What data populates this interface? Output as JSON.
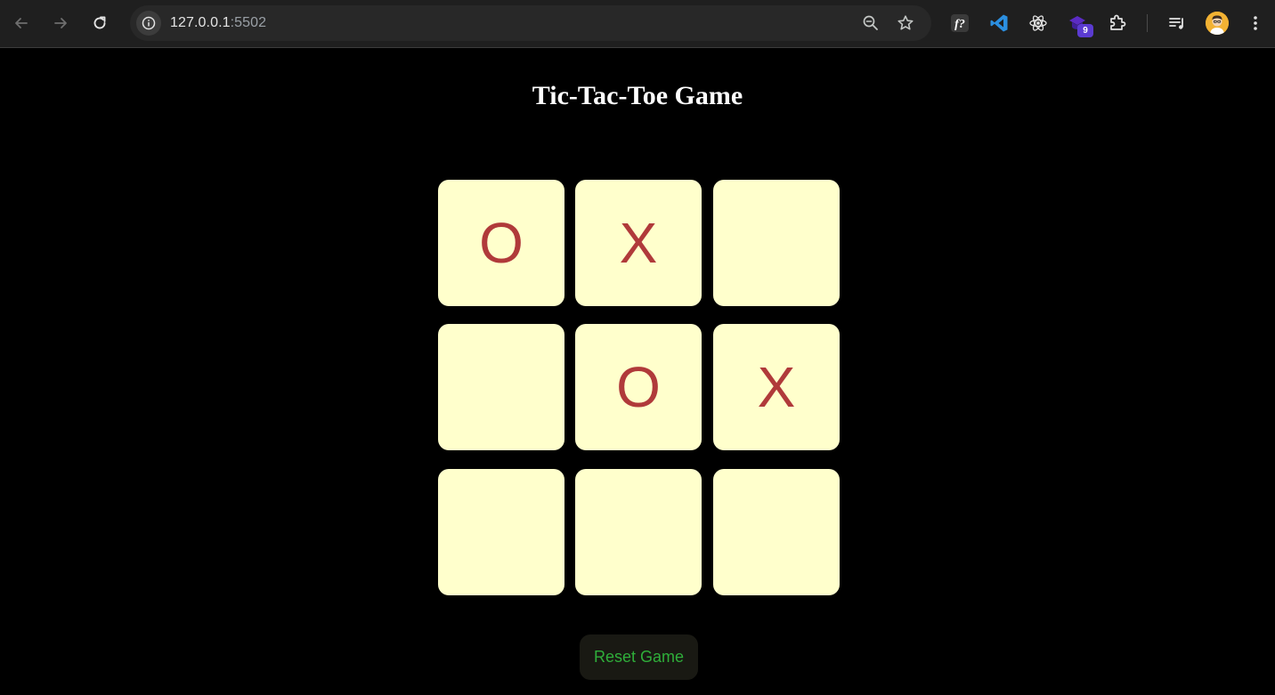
{
  "browser": {
    "url_host": "127.0.0.1",
    "url_port": ":5502",
    "extension_badge": "9"
  },
  "page": {
    "title": "Tic-Tac-Toe Game",
    "board": [
      "O",
      "X",
      "",
      "",
      "O",
      "X",
      "",
      "",
      ""
    ],
    "reset_label": "Reset Game"
  },
  "colors": {
    "background": "#000000",
    "cell": "#ffffcc",
    "mark": "#b03a3a",
    "reset_text": "#2fae3a",
    "reset_bg": "#191913"
  },
  "icons": {
    "toolbar": [
      "back-icon",
      "forward-icon",
      "reload-icon"
    ],
    "omnibox": [
      "site-info-icon",
      "zoom-icon",
      "bookmark-star-icon"
    ],
    "extensions": [
      "function-extension-icon",
      "vscode-icon",
      "react-devtools-icon",
      "purple-extension-icon",
      "extensions-puzzle-icon",
      "reading-list-icon",
      "profile-avatar",
      "menu-kebab-icon"
    ]
  }
}
